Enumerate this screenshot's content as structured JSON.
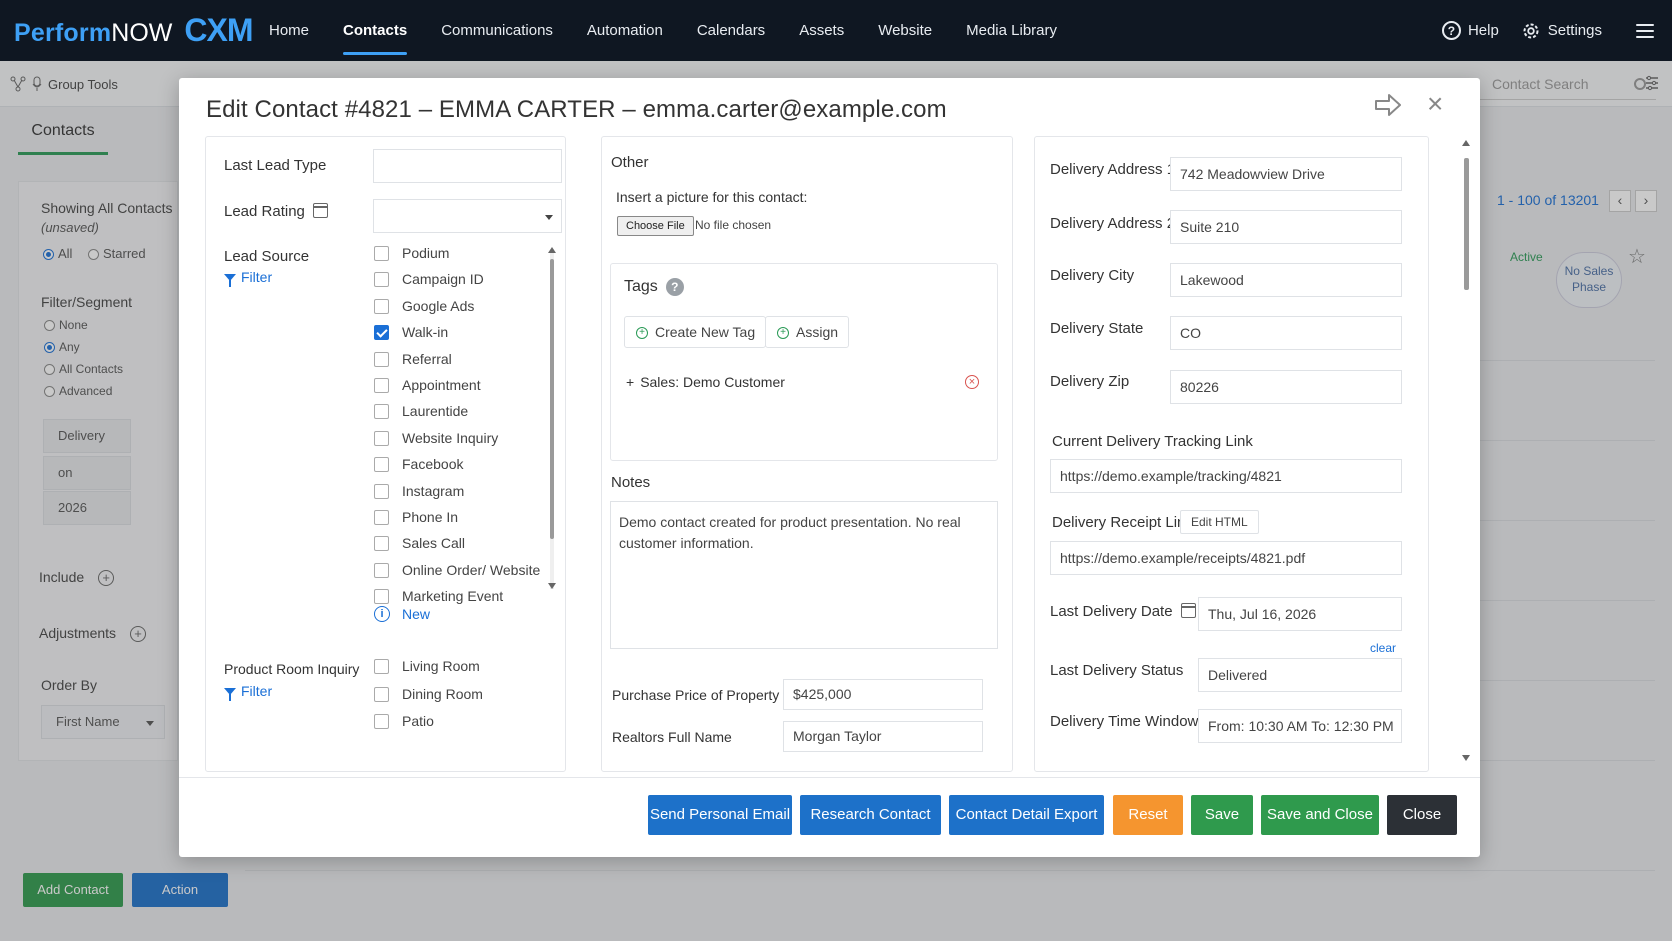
{
  "brand": {
    "perform": "Perform",
    "now": "NOW",
    "cxm": "CXM"
  },
  "nav": {
    "items": [
      "Home",
      "Contacts",
      "Communications",
      "Automation",
      "Calendars",
      "Assets",
      "Website",
      "Media Library"
    ],
    "active": "Contacts",
    "help": "Help",
    "settings": "Settings"
  },
  "background": {
    "group_tools": "Group Tools",
    "contacts_tab": "Contacts",
    "contact_search_placeholder": "Contact Search",
    "showing": "Showing All Contacts",
    "unsaved": "(unsaved)",
    "all": "All",
    "starred": "Starred",
    "filter_segment": "Filter/Segment",
    "filter_options": [
      "None",
      "Any",
      "All Contacts",
      "Advanced"
    ],
    "filter_selected": "Any",
    "segment_values": [
      "Delivery",
      "on",
      "2026"
    ],
    "include": "Include",
    "adjustments": "Adjustments",
    "order_by": "Order By",
    "order_by_value": "First Name",
    "add_contact": "Add Contact",
    "action": "Action",
    "paging": "1 - 100 of 13201",
    "active_status": "Active",
    "sales_phase": "No Sales Phase"
  },
  "modal": {
    "title": "Edit Contact #4821 – EMMA CARTER – emma.carter@example.com",
    "left": {
      "last_lead_type_label": "Last Lead Type",
      "last_lead_type_value": "",
      "lead_rating_label": "Lead Rating",
      "lead_rating_value": "",
      "lead_source_label": "Lead Source",
      "filter": "Filter",
      "lead_sources": [
        {
          "label": "Podium",
          "checked": false
        },
        {
          "label": "Campaign ID",
          "checked": false
        },
        {
          "label": "Google Ads",
          "checked": false
        },
        {
          "label": "Walk-in",
          "checked": true
        },
        {
          "label": "Referral",
          "checked": false
        },
        {
          "label": "Appointment",
          "checked": false
        },
        {
          "label": "Laurentide",
          "checked": false
        },
        {
          "label": "Website Inquiry",
          "checked": false
        },
        {
          "label": "Facebook",
          "checked": false
        },
        {
          "label": "Instagram",
          "checked": false
        },
        {
          "label": "Phone In",
          "checked": false
        },
        {
          "label": "Sales Call",
          "checked": false
        },
        {
          "label": "Online Order/ Website",
          "checked": false
        },
        {
          "label": "Marketing Event",
          "checked": false
        }
      ],
      "new_label": "New",
      "product_room_label": "Product Room Inquiry",
      "product_rooms": [
        {
          "label": "Living Room",
          "checked": false
        },
        {
          "label": "Dining Room",
          "checked": false
        },
        {
          "label": "Patio",
          "checked": false
        }
      ]
    },
    "middle": {
      "other": "Other",
      "picture_label": "Insert a picture for this contact:",
      "choose_file": "Choose File",
      "no_file": "No file chosen",
      "tags_label": "Tags",
      "create_tag": "Create New Tag",
      "assign": "Assign",
      "tag_item": "Sales: Demo Customer",
      "notes_label": "Notes",
      "notes_value": "Demo contact created for product presentation. No real customer information.",
      "purchase_price_label": "Purchase Price of Property",
      "purchase_price_value": "$425,000",
      "realtor_label": "Realtors Full Name",
      "realtor_value": "Morgan Taylor"
    },
    "right": {
      "addr1_label": "Delivery Address 1",
      "addr1_value": "742 Meadowview Drive",
      "addr2_label": "Delivery Address 2",
      "addr2_value": "Suite 210",
      "city_label": "Delivery City",
      "city_value": "Lakewood",
      "state_label": "Delivery State",
      "state_value": "CO",
      "zip_label": "Delivery Zip",
      "zip_value": "80226",
      "tracking_label": "Current Delivery Tracking Link",
      "tracking_value": "https://demo.example/tracking/4821",
      "receipt_label": "Delivery Receipt Link",
      "edit_html": "Edit HTML",
      "receipt_value": "https://demo.example/receipts/4821.pdf",
      "last_date_label": "Last Delivery Date",
      "last_date_value": "Thu, Jul 16, 2026",
      "clear": "clear",
      "last_status_label": "Last Delivery Status",
      "last_status_value": "Delivered",
      "time_window_label": "Delivery Time Window",
      "time_window_value": "From: 10:30 AM To: 12:30 PM"
    },
    "buttons": {
      "send_email": "Send Personal Email",
      "research": "Research Contact",
      "export": "Contact Detail Export",
      "reset": "Reset",
      "save": "Save",
      "save_close": "Save and Close",
      "close": "Close"
    }
  },
  "colors": {
    "nav_bg": "#0f1722",
    "brand_blue": "#3ea0f5",
    "primary_blue": "#1d71c9",
    "orange": "#f5952f",
    "green": "#2f9a4d",
    "dark": "#2c3036"
  }
}
